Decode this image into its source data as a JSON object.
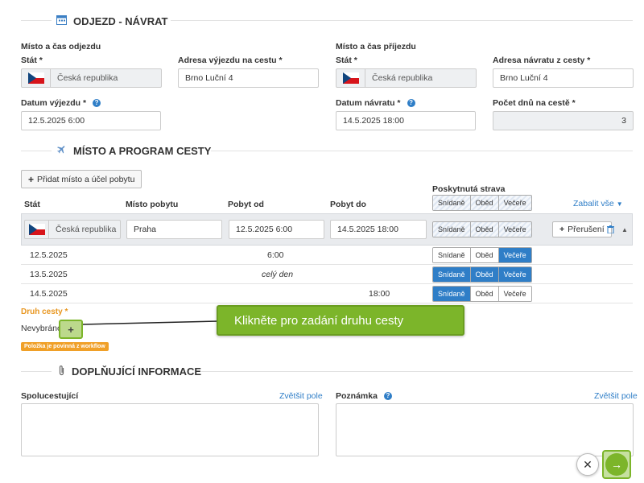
{
  "colors": {
    "accent": "#2f7ec7",
    "green": "#7cb52a",
    "orange": "#e8961f",
    "flag_red": "#d7141a",
    "flag_blue": "#11457e"
  },
  "section1": {
    "title": "ODJEZD - NÁVRAT",
    "departure_group": "Místo a čas odjezdu",
    "arrival_group": "Místo a čas příjezdu",
    "stat_label": "Stát *",
    "departure_country": "Česká republika",
    "arrival_country": "Česká republika",
    "dep_address_label": "Adresa výjezdu na cestu *",
    "dep_address_value": "Brno Luční 4",
    "ret_address_label": "Adresa návratu z cesty *",
    "ret_address_value": "Brno Luční 4",
    "dep_date_label": "Datum výjezdu *",
    "dep_date_value": "12.5.2025 6:00",
    "ret_date_label": "Datum návratu *",
    "ret_date_value": "14.5.2025 18:00",
    "days_label": "Počet dnů na cestě *",
    "days_value": "3"
  },
  "section2": {
    "title": "MÍSTO A PROGRAM CESTY",
    "add_button": "Přidat místo a účel pobytu",
    "headers": {
      "stat": "Stát",
      "misto": "Místo pobytu",
      "od": "Pobyt od",
      "do": "Pobyt do",
      "strava": "Poskytnutá strava"
    },
    "meals": {
      "breakfast": "Snídaně",
      "lunch": "Oběd",
      "dinner": "Večeře"
    },
    "collapse_link": "Zabalit vše",
    "stay": {
      "country": "Česká republika",
      "place": "Praha",
      "from": "12.5.2025 6:00",
      "to": "14.5.2025 18:00"
    },
    "interrupt_button": "Přerušení",
    "days": [
      {
        "date": "12.5.2025",
        "time": "6:00"
      },
      {
        "date": "13.5.2025",
        "time": "celý den"
      },
      {
        "date": "14.5.2025",
        "time": "18:00"
      }
    ],
    "trip_type_label": "Druh cesty *",
    "trip_type_value": "Nevybráno",
    "required_badge": "Položka je povinná z workflow",
    "tooltip": "Klikněte pro zadání  druhu cesty"
  },
  "section3": {
    "title": "DOPLŇUJÍCÍ INFORMACE",
    "companions_label": "Spolucestující",
    "note_label": "Poznámka",
    "enlarge": "Zvětšit pole"
  },
  "icons": {
    "calendar": "calendar-icon",
    "plane": "plane-icon",
    "clip": "paperclip-icon",
    "help": "help-icon",
    "plus": "plus-icon",
    "trash": "trash-icon",
    "caret_up": "caret-up-icon",
    "caret_down": "caret-down-icon",
    "close": "close-icon",
    "next": "arrow-right-icon"
  }
}
